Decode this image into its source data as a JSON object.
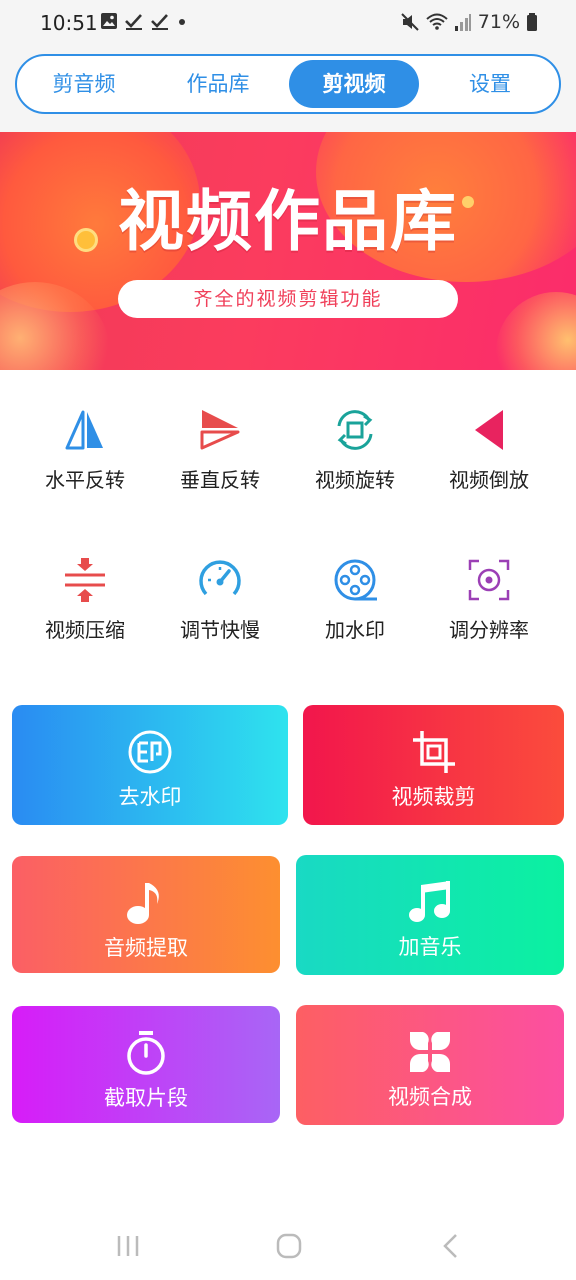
{
  "status_bar": {
    "time": "10:51",
    "battery": "71%"
  },
  "tabs": [
    {
      "label": "剪音频",
      "active": false
    },
    {
      "label": "作品库",
      "active": false
    },
    {
      "label": "剪视频",
      "active": true
    },
    {
      "label": "设置",
      "active": false
    }
  ],
  "banner": {
    "title": "视频作品库",
    "subtitle": "齐全的视频剪辑功能"
  },
  "tools": [
    {
      "label": "水平反转",
      "icon": "flip-horizontal-icon",
      "color": "#2f8fe6"
    },
    {
      "label": "垂直反转",
      "icon": "flip-vertical-icon",
      "color": "#e74c4c"
    },
    {
      "label": "视频旋转",
      "icon": "rotate-icon",
      "color": "#1aa39a"
    },
    {
      "label": "视频倒放",
      "icon": "reverse-play-icon",
      "color": "#e8235f"
    },
    {
      "label": "视频压缩",
      "icon": "compress-icon",
      "color": "#e74c4c"
    },
    {
      "label": "调节快慢",
      "icon": "speedometer-icon",
      "color": "#2f9fe0"
    },
    {
      "label": "加水印",
      "icon": "film-reel-icon",
      "color": "#2f8fe6"
    },
    {
      "label": "调分辨率",
      "icon": "resolution-icon",
      "color": "#9b3fb5"
    }
  ],
  "cards": [
    {
      "label": "去水印",
      "icon": "watermark-remove-icon"
    },
    {
      "label": "视频裁剪",
      "icon": "crop-icon"
    },
    {
      "label": "音频提取",
      "icon": "music-note-icon"
    },
    {
      "label": "加音乐",
      "icon": "music-notes-icon"
    },
    {
      "label": "截取片段",
      "icon": "stopwatch-icon"
    },
    {
      "label": "视频合成",
      "icon": "merge-icon"
    }
  ],
  "colors": {
    "accent": "#2f8fe6",
    "banner_red": "#fb3c5e"
  }
}
